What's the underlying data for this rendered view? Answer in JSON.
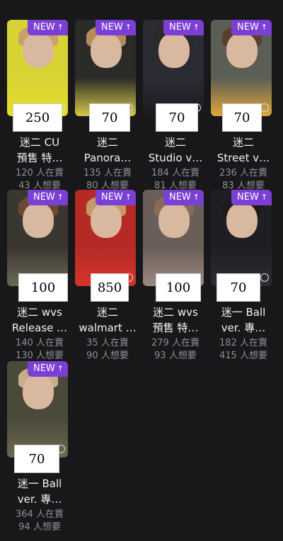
{
  "badge_label": "NEW",
  "badge_arrow": "↑",
  "cards": [
    {
      "price": "250",
      "title1": "迷二 CU",
      "title2": "預售 特…",
      "selling": "120 人在賣",
      "wanted": "43 人想要",
      "bg": "#d7d335",
      "hair": "#c9a069",
      "shirt": "#e7df2c"
    },
    {
      "price": "70",
      "title1": "迷二",
      "title2": "Panora…",
      "selling": "135 人在賣",
      "wanted": "80 人想要",
      "bg": "#2a2a28",
      "hair": "#b88a5a",
      "shirt": "#d4c94a"
    },
    {
      "price": "70",
      "title1": "迷二",
      "title2": "Studio v…",
      "selling": "184 人在賣",
      "wanted": "81 人想要",
      "bg": "#2b2b33",
      "hair": "#2a2a2a",
      "shirt": "#1a1a1e"
    },
    {
      "price": "70",
      "title1": "迷二",
      "title2": "Street v…",
      "selling": "236 人在賣",
      "wanted": "83 人想要",
      "bg": "#5a5e55",
      "hair": "#5a3f2e",
      "shirt": "#e0a63a"
    },
    {
      "price": "100",
      "title1": "迷二 wvs",
      "title2": "Release …",
      "selling": "140 人在賣",
      "wanted": "130 人想要",
      "bg": "#3a3630",
      "hair": "#6b4a34",
      "shirt": "#6b6a57"
    },
    {
      "price": "850",
      "title1": "迷二",
      "title2": "walmart …",
      "selling": "35 人在賣",
      "wanted": "90 人想要",
      "bg": "#b52a25",
      "hair": "#c49a6a",
      "shirt": "#d7342c"
    },
    {
      "price": "100",
      "title1": "迷二 wvs",
      "title2": "預售 特…",
      "selling": "279 人在賣",
      "wanted": "93 人想要",
      "bg": "#6a5e58",
      "hair": "#8b6a56",
      "shirt": "#9a8a82"
    },
    {
      "price": "70",
      "title1": "迷一 Ball",
      "title2": "ver. 專…",
      "selling": "182 人在賣",
      "wanted": "415 人想要",
      "bg": "#1d1f22",
      "hair": "#1b1b1b",
      "shirt": "#2b2d30"
    },
    {
      "price": "70",
      "title1": "迷一 Ball",
      "title2": "ver. 專…",
      "selling": "364 人在賣",
      "wanted": "94 人想要",
      "bg": "#4b4a3a",
      "hair": "#c8ad8a",
      "shirt": "#6c6a4e"
    }
  ]
}
